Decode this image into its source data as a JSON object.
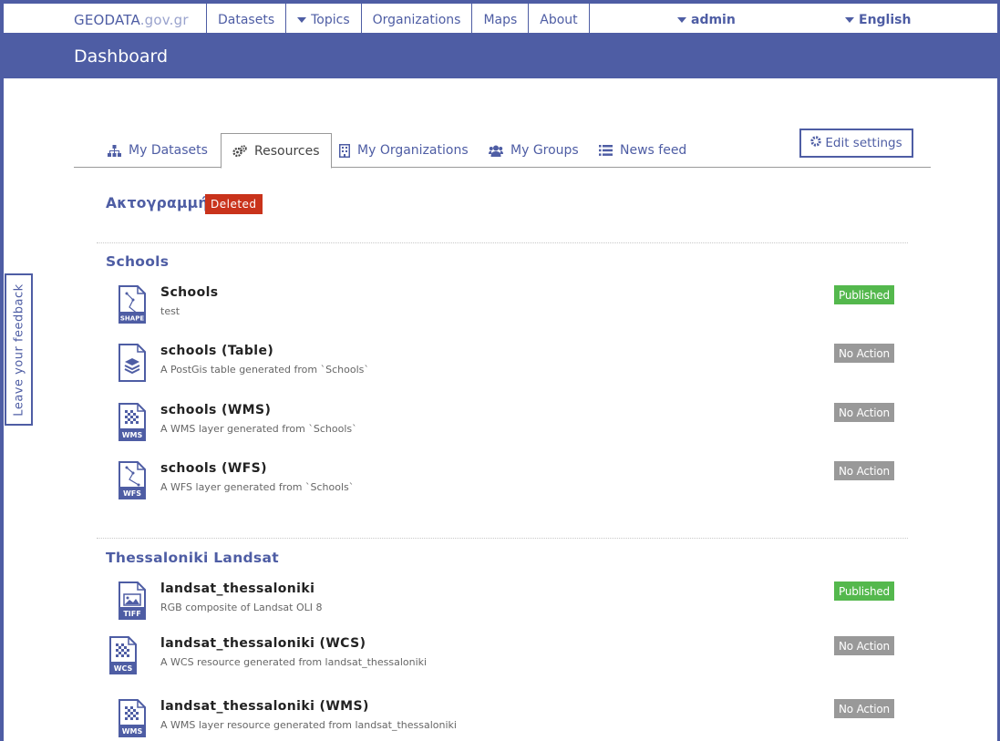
{
  "nav": {
    "brand_main": "GEODATA",
    "brand_suffix": ".gov.gr",
    "items": [
      "Datasets",
      "Topics",
      "Organizations",
      "Maps",
      "About"
    ],
    "user": "admin",
    "language": "English"
  },
  "page": {
    "title": "Dashboard"
  },
  "tabs": {
    "my_datasets": "My Datasets",
    "resources": "Resources",
    "my_organizations": "My Organizations",
    "my_groups": "My Groups",
    "news_feed": "News feed",
    "edit_settings": "Edit settings"
  },
  "groups": [
    {
      "title": "Ακτογραμμή",
      "badge": "Deleted",
      "resources": []
    },
    {
      "title": "Schools",
      "resources": [
        {
          "name": "Schools",
          "description": "test",
          "status": "Published",
          "icon": "shape-file-icon",
          "icon_label": "SHAPE"
        },
        {
          "name": "schools (Table)",
          "description": "A PostGis table generated from `Schools`",
          "status": "No Action",
          "icon": "table-file-icon",
          "icon_label": ""
        },
        {
          "name": "schools (WMS)",
          "description": "A WMS layer generated from `Schools`",
          "status": "No Action",
          "icon": "wms-file-icon",
          "icon_label": "WMS"
        },
        {
          "name": "schools (WFS)",
          "description": "A WFS layer generated from `Schools`",
          "status": "No Action",
          "icon": "wfs-file-icon",
          "icon_label": "WFS"
        }
      ]
    },
    {
      "title": "Thessaloniki Landsat",
      "resources": [
        {
          "name": "landsat_thessaloniki",
          "description": "RGB composite of Landsat OLI 8",
          "status": "Published",
          "icon": "tiff-file-icon",
          "icon_label": "TIFF"
        },
        {
          "name": "landsat_thessaloniki (WCS)",
          "description": "A WCS resource generated from landsat_thessaloniki",
          "status": "No Action",
          "icon": "wcs-file-icon",
          "icon_label": "WCS"
        },
        {
          "name": "landsat_thessaloniki (WMS)",
          "description": "A WMS layer resource generated from landsat_thessaloniki",
          "status": "No Action",
          "icon": "wms-file-icon",
          "icon_label": "WMS"
        }
      ]
    }
  ],
  "feedback": {
    "label": "Leave your feedback"
  },
  "colors": {
    "brand": "#4e5da4",
    "published": "#54b84d",
    "no_action": "#999999",
    "deleted": "#c9331b"
  }
}
